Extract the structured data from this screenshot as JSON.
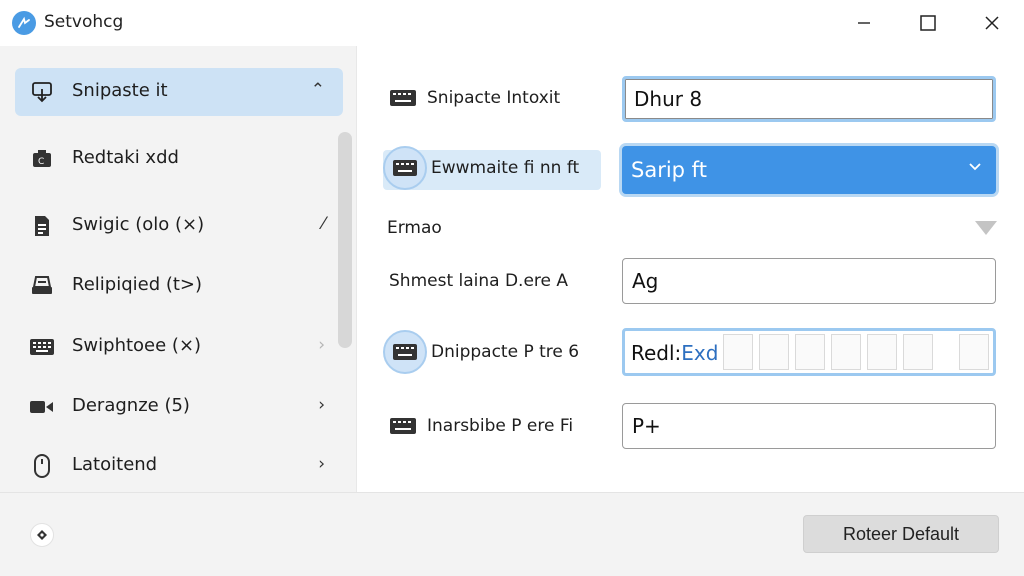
{
  "window": {
    "title": "Setvohcg"
  },
  "sidebar": {
    "items": [
      {
        "label": "Snipaste it",
        "arrow": "⌃",
        "icon": "monitor-download-icon"
      },
      {
        "label": "Redtaki xdd",
        "arrow": "",
        "icon": "camera-icon"
      },
      {
        "label": "Swigic (olo (×)",
        "arrow": "⁄",
        "icon": "document-icon"
      },
      {
        "label": "Relipiqied (t>)",
        "arrow": "",
        "icon": "printer-icon"
      },
      {
        "label": "Swiphtoee (×)",
        "arrow": "›",
        "icon": "keyboard-icon"
      },
      {
        "label": "Deragnze (5)",
        "arrow": "›",
        "icon": "video-icon"
      },
      {
        "label": "Latoitend",
        "arrow": "›",
        "icon": "mouse-icon"
      }
    ]
  },
  "content": {
    "rows": [
      {
        "label": "Snipacte Intoxit",
        "value": "Dhur 8"
      },
      {
        "label": "Ewwmaite fi nn ft",
        "value": "Sarip ft"
      },
      {
        "label": "Ermao",
        "value": ""
      },
      {
        "label": "Shmest laina D.ere A",
        "value": "Ag"
      },
      {
        "label": "Dnippacte P tre 6",
        "value_prefix": "Redl:",
        "value_highlight": "Exd"
      },
      {
        "label": "Inarsbibe P ere Fi",
        "value": "P+"
      }
    ]
  },
  "footer": {
    "reset_label": "Roteer Default"
  },
  "colors": {
    "accent": "#3f93e6",
    "selection": "#cde2f5",
    "focus_ring": "#9cc9f0"
  }
}
